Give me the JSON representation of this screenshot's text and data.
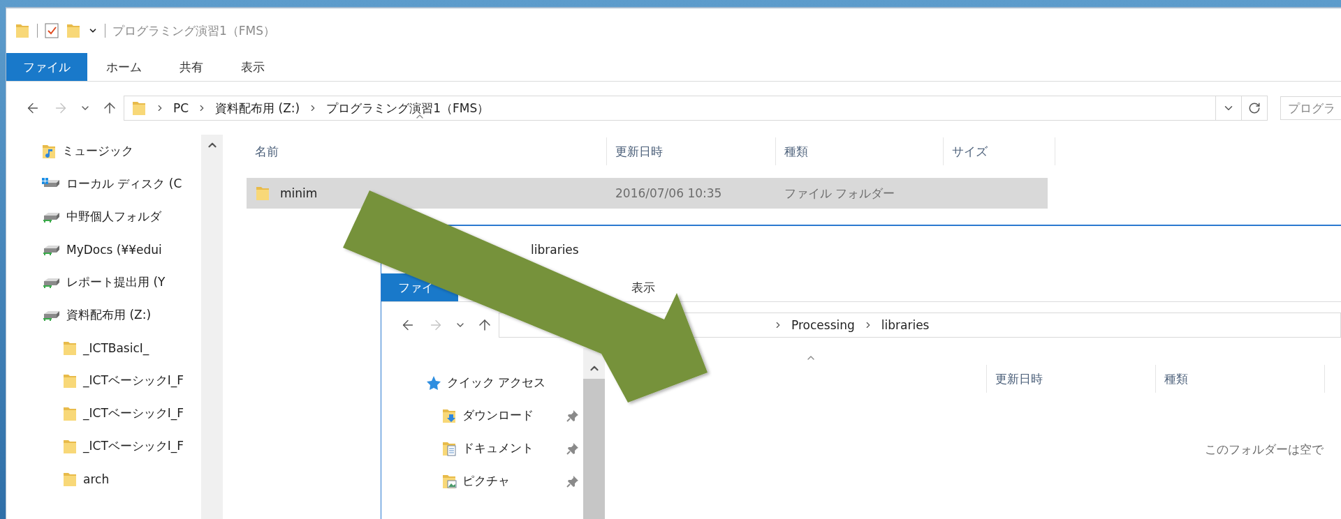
{
  "main_window": {
    "title": "プログラミング演習1（FMS）",
    "ribbon_tabs": [
      {
        "label": "ファイル",
        "selected": true
      },
      {
        "label": "ホーム",
        "selected": false
      },
      {
        "label": "共有",
        "selected": false
      },
      {
        "label": "表示",
        "selected": false
      }
    ],
    "address": {
      "breadcrumbs": [
        "PC",
        "資料配布用 (Z:)",
        "プログラミング演習1（FMS）"
      ]
    },
    "search": {
      "placeholder": "プログラ"
    },
    "nav_pane": {
      "items": [
        {
          "label": "ミュージック",
          "kind": "music"
        },
        {
          "label": "ローカル ディスク (C",
          "kind": "system-drive"
        },
        {
          "label": "中野個人フォルダ",
          "kind": "network-drive"
        },
        {
          "label": "MyDocs (¥¥edui",
          "kind": "network-drive"
        },
        {
          "label": "レポート提出用 (Y",
          "kind": "network-drive"
        },
        {
          "label": "資料配布用 (Z:)",
          "kind": "network-drive",
          "children": [
            {
              "label": "_ICTBasicI_",
              "kind": "folder"
            },
            {
              "label": "_ICTベーシックI_F",
              "kind": "folder"
            },
            {
              "label": "_ICTベーシックI_F",
              "kind": "folder"
            },
            {
              "label": "_ICTベーシックI_F",
              "kind": "folder"
            },
            {
              "label": "arch",
              "kind": "folder"
            }
          ]
        }
      ]
    },
    "columns": [
      "名前",
      "更新日時",
      "種類",
      "サイズ"
    ],
    "rows": [
      {
        "name": "minim",
        "modified": "2016/07/06 10:35",
        "type": "ファイル フォルダー",
        "selected": true
      }
    ]
  },
  "second_window": {
    "title": "libraries",
    "ribbon_tabs": [
      {
        "label": "ファイ",
        "selected": true
      },
      {
        "label": "表示",
        "selected": false
      }
    ],
    "address": {
      "breadcrumbs": [
        "Processing",
        "libraries"
      ]
    },
    "nav_pane": {
      "items": [
        {
          "label": "クイック アクセス",
          "kind": "quick-access",
          "children": [
            {
              "label": "ダウンロード",
              "kind": "downloads",
              "pinned": true
            },
            {
              "label": "ドキュメント",
              "kind": "documents",
              "pinned": true
            },
            {
              "label": "ピクチャ",
              "kind": "pictures",
              "pinned": true
            }
          ]
        }
      ]
    },
    "columns": [
      "更新日時",
      "種類"
    ],
    "empty_message": "このフォルダーは空で"
  }
}
